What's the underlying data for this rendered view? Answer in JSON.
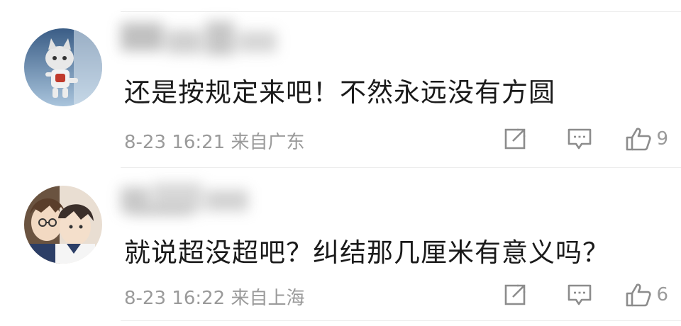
{
  "comments": [
    {
      "text": "还是按规定来吧！不然永远没有方圆",
      "time": "8-23 16:21",
      "location": "来自广东",
      "likes": "9",
      "avatar_icon": "robot-cat-avatar-icon"
    },
    {
      "text": "就说超没超吧？纠结那几厘米有意义吗？",
      "time": "8-23 16:22",
      "location": "来自上海",
      "likes": "6",
      "avatar_icon": "anime-couple-avatar-icon"
    }
  ],
  "icons": {
    "forward": "share-forward-icon",
    "reply": "comment-bubble-icon",
    "like": "thumbs-up-icon"
  },
  "colors": {
    "text": "#1a1a1a",
    "meta": "#9a9a9a",
    "icon": "#8c8c8c",
    "divider": "#ececec"
  }
}
